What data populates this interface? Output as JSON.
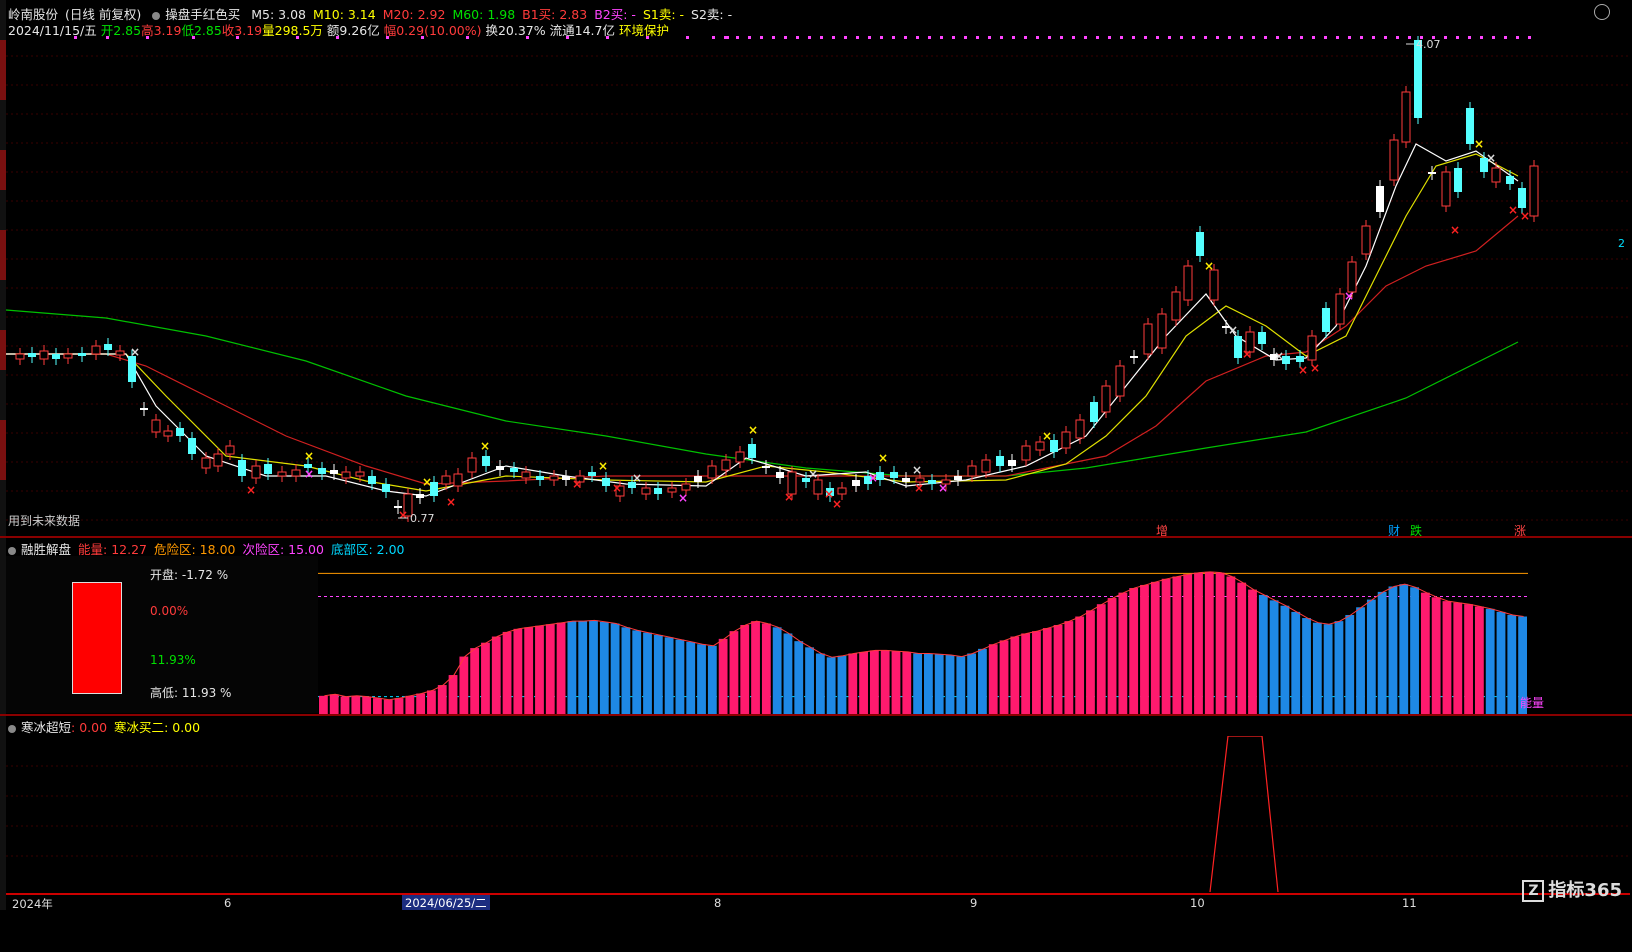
{
  "stock": {
    "name": "岭南股份",
    "mode": "(日线 前复权)",
    "indicator_name": "操盘手红色买",
    "ma5": "M5: 3.08",
    "ma10": "M10: 3.14",
    "ma20": "M20: 2.92",
    "ma60": "M60: 1.98",
    "b1": "B1买: 2.83",
    "b2": "B2买: -",
    "s1": "S1卖: -",
    "s2": "S2卖: -"
  },
  "quote": {
    "date": "2024/11/15/五",
    "open": "开2.85",
    "high": "高3.19",
    "low": "低2.85",
    "close": "收3.19",
    "volume": "量298.5万",
    "amount": "额9.26亿",
    "change": "幅0.29(10.00%)",
    "turnover": "换20.37%",
    "float": "流通14.7亿",
    "tag": "环境保护"
  },
  "main": {
    "future_note": "用到未来数据",
    "max_label": "4.07",
    "min_label": "0.77",
    "price_right": "2",
    "events": [
      {
        "label": "增",
        "color": "#ff4444"
      },
      {
        "label": "财",
        "color": "#00a0ff"
      },
      {
        "label": "跌",
        "color": "#00e000"
      },
      {
        "label": "涨",
        "color": "#ff4444"
      }
    ]
  },
  "panel1": {
    "title": "融胜解盘",
    "energy": "能量: 12.27",
    "danger": "危险区: 18.00",
    "sub_danger": "次险区: 15.00",
    "bottom_zone": "底部区: 2.00",
    "open_label": "开盘:",
    "open_val": "-1.72 %",
    "mid_pct": "0.00%",
    "green_pct": "11.93%",
    "hl_label": "高低:",
    "hl_val": "11.93 %",
    "energy_tag": "能量",
    "values": [
      2.1,
      2.3,
      2.0,
      2.1,
      2.0,
      1.8,
      1.6,
      1.8,
      2.1,
      2.4,
      2.8,
      3.5,
      4.8,
      7.2,
      8.3,
      9.0,
      9.8,
      10.4,
      10.8,
      11.0,
      11.2,
      11.4,
      11.6,
      11.8,
      11.8,
      11.9,
      11.7,
      11.5,
      11.0,
      10.6,
      10.3,
      10.0,
      9.7,
      9.4,
      9.1,
      8.8,
      8.6,
      9.5,
      10.5,
      11.3,
      11.8,
      11.5,
      11.0,
      10.2,
      9.2,
      8.4,
      7.6,
      7.1,
      7.3,
      7.6,
      7.8,
      8.0,
      8.0,
      7.9,
      7.8,
      7.6,
      7.6,
      7.5,
      7.4,
      7.2,
      7.6,
      8.2,
      8.8,
      9.3,
      9.8,
      10.2,
      10.5,
      10.9,
      11.3,
      11.8,
      12.4,
      13.2,
      14.0,
      14.8,
      15.5,
      16.1,
      16.5,
      16.9,
      17.3,
      17.6,
      17.9,
      18.1,
      18.2,
      18.1,
      17.6,
      16.8,
      15.9,
      15.2,
      14.5,
      13.8,
      13.0,
      12.2,
      11.6,
      11.4,
      11.8,
      12.6,
      13.6,
      14.6,
      15.6,
      16.3,
      16.6,
      16.2,
      15.5,
      14.9,
      14.4,
      14.2,
      14.0,
      13.7,
      13.4,
      13.0,
      12.6,
      12.4
    ],
    "colors": "rrrrrrrrrrrrrrrrrrrrrrrbbbbbbbbbbbbbbrrrrrbbbbbbbrrrrrrbbbbbbbrrrrrrrrrrrrrrrrrrrrrrrrrbbbbbbbbbbbbbbbrrrrrrbbbbbbbbbbb",
    "ylim": [
      0,
      20
    ],
    "danger_line": 18,
    "sub_line": 15,
    "bottom_line": 2
  },
  "panel2": {
    "title": "寒冰超短",
    "v1": ": 0.00",
    "v2_label": "寒冰买二",
    "v2": ": 0.00"
  },
  "axis": {
    "ticks": [
      "2024年",
      "6",
      "8",
      "9",
      "10",
      "11"
    ],
    "cursor_date": "2024/06/25/二"
  },
  "logo": "指标365"
}
